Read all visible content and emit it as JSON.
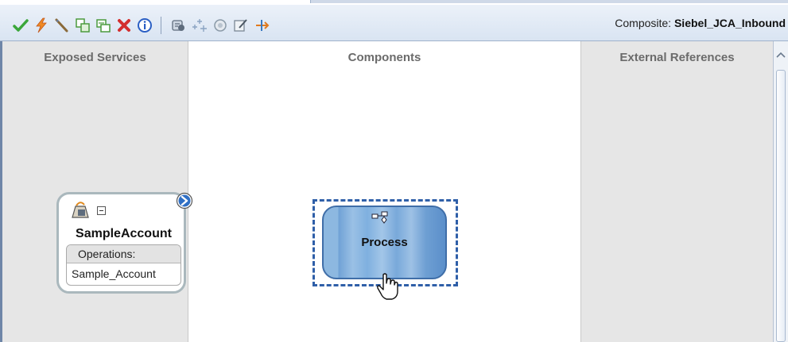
{
  "toolbar": {
    "buttons": [
      {
        "name": "validate-icon",
        "color": "#3aa63a"
      },
      {
        "name": "lightning-icon",
        "color": "#e8731b"
      },
      {
        "name": "wire-icon",
        "color": "#7a5a2a"
      },
      {
        "name": "copy-icon",
        "color": "#4b9a3d"
      },
      {
        "name": "paste-icon",
        "color": "#4b9a3d"
      },
      {
        "name": "delete-icon",
        "color": "#d32f2f"
      },
      {
        "name": "info-icon",
        "color": "#2b5fc4"
      },
      {
        "name": "database-icon",
        "color": "#5e6c7d"
      },
      {
        "name": "sparkle-icon",
        "color": "#8aa3c2"
      },
      {
        "name": "service-icon",
        "color": "#8a9aa8"
      },
      {
        "name": "edit-icon",
        "color": "#7a8795"
      },
      {
        "name": "route-icon",
        "color": "#e07a1e"
      }
    ],
    "composite_label": "Composite:",
    "composite_name": "Siebel_JCA_Inbound"
  },
  "columns": {
    "left_title": "Exposed Services",
    "middle_title": "Components",
    "right_title": "External References"
  },
  "service": {
    "name": "SampleAccount",
    "operations_header": "Operations:",
    "operation": "Sample_Account"
  },
  "component": {
    "name": "Process"
  }
}
